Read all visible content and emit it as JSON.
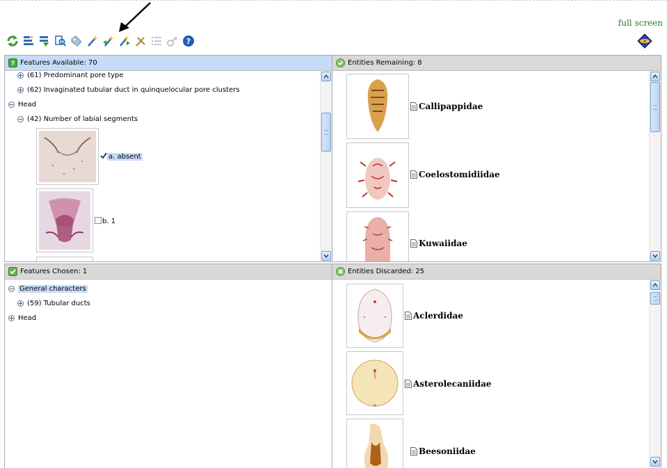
{
  "header": {
    "full_screen_label": "full screen"
  },
  "toolbar": {
    "buttons": [
      {
        "name": "restart-icon",
        "color": "#3c9a2a"
      },
      {
        "name": "sort-features-icon",
        "color": "#2d6eb3"
      },
      {
        "name": "best-features-icon",
        "color": "#2d6eb3"
      },
      {
        "name": "find-icon",
        "color": "#2d6eb3"
      },
      {
        "name": "tag-icon",
        "color": "#8aa8c8"
      },
      {
        "name": "wand-icon",
        "color": "#2d6eb3"
      },
      {
        "name": "wand-back-icon",
        "color": "#3c9a2a"
      },
      {
        "name": "wand-forward-icon",
        "color": "#3c9a2a"
      },
      {
        "name": "tools-icon",
        "color": "#d7a43a"
      },
      {
        "name": "list-icon",
        "color": "#a0b4c8"
      },
      {
        "name": "key-icon",
        "color": "#b8c4d0"
      },
      {
        "name": "help-icon",
        "color": "#1f5fb4"
      }
    ]
  },
  "features_available": {
    "title": "Features Available: 70",
    "rows": [
      {
        "text": "(61) Predominant pore type",
        "toggle": "plus"
      },
      {
        "text": "(62) Invaginated tubular duct in quinquelocular pore clusters",
        "toggle": "plus"
      },
      {
        "text": "Head",
        "toggle": "minus"
      },
      {
        "text": "(42) Number of labial segments",
        "toggle": "minus"
      }
    ],
    "states": [
      {
        "label": "a. absent",
        "checked": true
      },
      {
        "label": "b. 1",
        "checked": false
      }
    ]
  },
  "entities_remaining": {
    "title": "Entities Remaining: 8",
    "items": [
      "Callipappidae",
      "Coelostomidiidae",
      "Kuwaiidae"
    ]
  },
  "features_chosen": {
    "title": "Features Chosen: 1",
    "rows": [
      {
        "text": "General characters",
        "toggle": "minus"
      },
      {
        "text": "(59) Tubular ducts",
        "toggle": "plus"
      },
      {
        "text": "Head",
        "toggle": "plus"
      }
    ]
  },
  "entities_discarded": {
    "title": "Entities Discarded: 25",
    "items": [
      "Aclerdidae",
      "Asterolecaniidae",
      "Beesoniidae"
    ]
  },
  "colors": {
    "header_bg": "#d9d9d9",
    "header_active_bg": "#c6dbf8",
    "selection": "#c6dbf8",
    "full_screen_link": "#2a7a2a"
  }
}
